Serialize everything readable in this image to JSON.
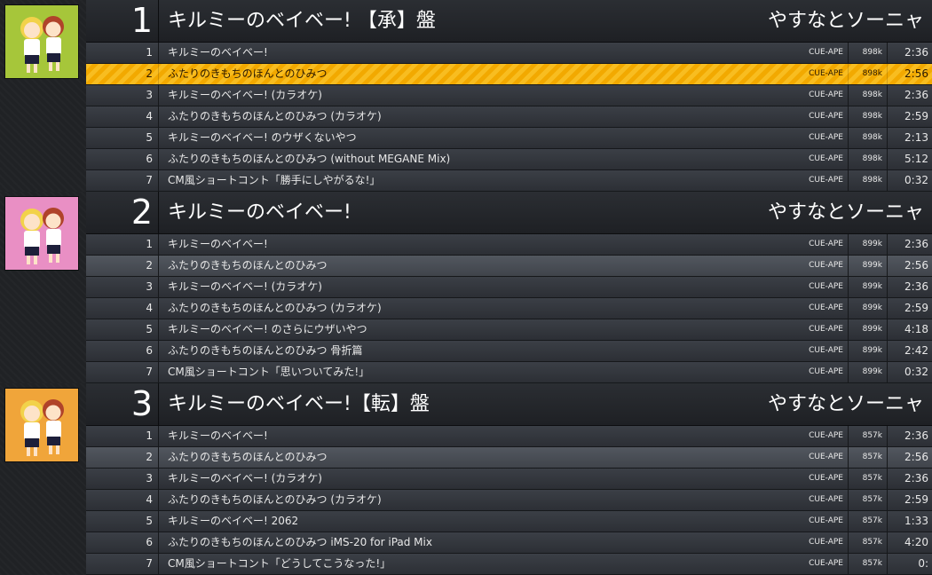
{
  "colors": {
    "playing_row": "#f2a900",
    "background": "#1b1d20",
    "row": "#3b3f46",
    "row_alt": "#52575f"
  },
  "groups": [
    {
      "disc": "1",
      "album": "キルミーのベイベー! 【承】盤",
      "artist": "やすなとソーニャ",
      "art_colors": {
        "bg": "#a6c63a",
        "accent": "#f2d24a"
      },
      "tracks": [
        {
          "num": "1",
          "title": "キルミーのベイベー!",
          "codec": "CUE-APE",
          "bitrate": "898k",
          "length": "2:36",
          "state": "normal"
        },
        {
          "num": "2",
          "title": "ふたりのきもちのほんとのひみつ",
          "codec": "CUE-APE",
          "bitrate": "898k",
          "length": "2:56",
          "state": "playing"
        },
        {
          "num": "3",
          "title": "キルミーのベイベー! (カラオケ)",
          "codec": "CUE-APE",
          "bitrate": "898k",
          "length": "2:36",
          "state": "normal"
        },
        {
          "num": "4",
          "title": "ふたりのきもちのほんとのひみつ (カラオケ)",
          "codec": "CUE-APE",
          "bitrate": "898k",
          "length": "2:59",
          "state": "normal"
        },
        {
          "num": "5",
          "title": "キルミーのベイベー! のウザくないやつ",
          "codec": "CUE-APE",
          "bitrate": "898k",
          "length": "2:13",
          "state": "normal"
        },
        {
          "num": "6",
          "title": "ふたりのきもちのほんとのひみつ (without MEGANE Mix)",
          "codec": "CUE-APE",
          "bitrate": "898k",
          "length": "5:12",
          "state": "normal"
        },
        {
          "num": "7",
          "title": "CM風ショートコント「勝手にしやがるな!」",
          "codec": "CUE-APE",
          "bitrate": "898k",
          "length": "0:32",
          "state": "normal"
        }
      ]
    },
    {
      "disc": "2",
      "album": "キルミーのベイベー!",
      "artist": "やすなとソーニャ",
      "art_colors": {
        "bg": "#e98fc4",
        "accent": "#f2d24a"
      },
      "tracks": [
        {
          "num": "1",
          "title": "キルミーのベイベー!",
          "codec": "CUE-APE",
          "bitrate": "899k",
          "length": "2:36",
          "state": "normal"
        },
        {
          "num": "2",
          "title": "ふたりのきもちのほんとのひみつ",
          "codec": "CUE-APE",
          "bitrate": "899k",
          "length": "2:56",
          "state": "alt"
        },
        {
          "num": "3",
          "title": "キルミーのベイベー! (カラオケ)",
          "codec": "CUE-APE",
          "bitrate": "899k",
          "length": "2:36",
          "state": "normal"
        },
        {
          "num": "4",
          "title": "ふたりのきもちのほんとのひみつ (カラオケ)",
          "codec": "CUE-APE",
          "bitrate": "899k",
          "length": "2:59",
          "state": "normal"
        },
        {
          "num": "5",
          "title": "キルミーのベイベー! のさらにウザいやつ",
          "codec": "CUE-APE",
          "bitrate": "899k",
          "length": "4:18",
          "state": "normal"
        },
        {
          "num": "6",
          "title": "ふたりのきもちのほんとのひみつ 骨折篇",
          "codec": "CUE-APE",
          "bitrate": "899k",
          "length": "2:42",
          "state": "normal"
        },
        {
          "num": "7",
          "title": "CM風ショートコント「思いついてみた!」",
          "codec": "CUE-APE",
          "bitrate": "899k",
          "length": "0:32",
          "state": "normal"
        }
      ]
    },
    {
      "disc": "3",
      "album": "キルミーのベイベー!【転】盤",
      "artist": "やすなとソーニャ",
      "art_colors": {
        "bg": "#f0a53a",
        "accent": "#f2d24a"
      },
      "tracks": [
        {
          "num": "1",
          "title": "キルミーのベイベー!",
          "codec": "CUE-APE",
          "bitrate": "857k",
          "length": "2:36",
          "state": "normal"
        },
        {
          "num": "2",
          "title": "ふたりのきもちのほんとのひみつ",
          "codec": "CUE-APE",
          "bitrate": "857k",
          "length": "2:56",
          "state": "alt"
        },
        {
          "num": "3",
          "title": "キルミーのベイベー! (カラオケ)",
          "codec": "CUE-APE",
          "bitrate": "857k",
          "length": "2:36",
          "state": "normal"
        },
        {
          "num": "4",
          "title": "ふたりのきもちのほんとのひみつ (カラオケ)",
          "codec": "CUE-APE",
          "bitrate": "857k",
          "length": "2:59",
          "state": "normal"
        },
        {
          "num": "5",
          "title": "キルミーのベイベー! 2062",
          "codec": "CUE-APE",
          "bitrate": "857k",
          "length": "1:33",
          "state": "normal"
        },
        {
          "num": "6",
          "title": "ふたりのきもちのほんとのひみつ iMS-20 for iPad Mix",
          "codec": "CUE-APE",
          "bitrate": "857k",
          "length": "4:20",
          "state": "normal"
        },
        {
          "num": "7",
          "title": "CM風ショートコント「どうしてこうなった!」",
          "codec": "CUE-APE",
          "bitrate": "857k",
          "length": "0:",
          "state": "normal"
        }
      ]
    }
  ]
}
